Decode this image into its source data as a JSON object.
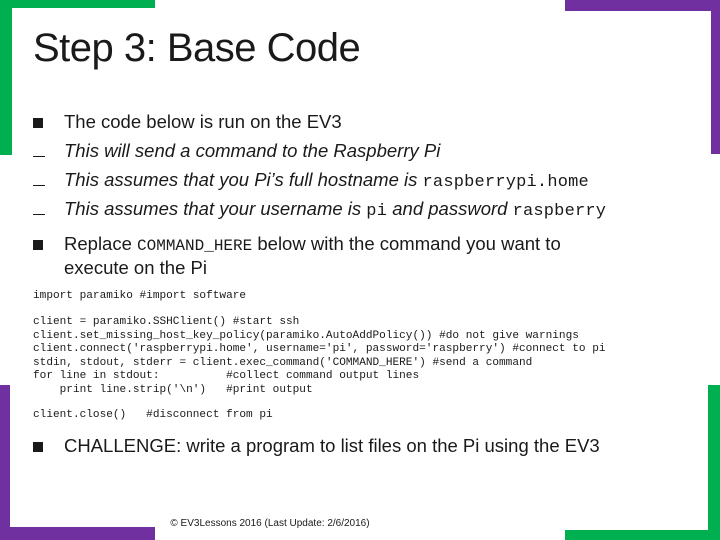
{
  "slide": {
    "title": "Step 3: Base Code",
    "bullets": [
      {
        "type": "square",
        "text": "The code below is run on the EV3"
      },
      {
        "type": "dash",
        "text": "This will send a command to the Raspberry Pi"
      },
      {
        "type": "dash",
        "prefix": "This assumes that you Pi’s full hostname is ",
        "code": "raspberrypi.home"
      },
      {
        "type": "dash",
        "prefix": "This assumes that your username is ",
        "code1": "pi",
        "middle": " and password ",
        "code2": "raspberry"
      }
    ],
    "replace_bullet": {
      "prefix": "Replace ",
      "code": "COMMAND_HERE",
      "suffix": " below with the command you want to",
      "line2": "execute on the Pi"
    },
    "code_blocks": [
      "import paramiko #import software",
      "client = paramiko.SSHClient() #start ssh\nclient.set_missing_host_key_policy(paramiko.AutoAddPolicy()) #do not give warnings\nclient.connect('raspberrypi.home', username='pi', password='raspberry') #connect to pi\nstdin, stdout, stderr = client.exec_command('COMMAND_HERE') #send a command\nfor line in stdout:          #collect command output lines\n    print line.strip('\\n')   #print output",
      "client.close()   #disconnect from pi"
    ],
    "challenge": "CHALLENGE: write a program to list files on the Pi using the EV3",
    "footer": "© EV3Lessons 2016 (Last Update: 2/6/2016)"
  },
  "colors": {
    "accent_green": "#00b050",
    "accent_purple": "#7030a0",
    "text": "#1a1a1a"
  }
}
